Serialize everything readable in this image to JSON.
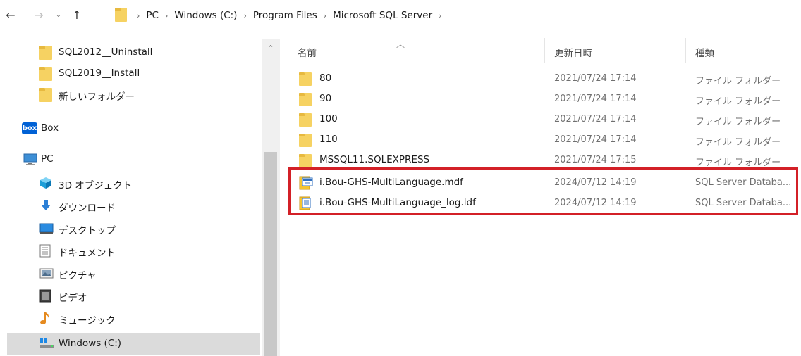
{
  "breadcrumb": [
    "PC",
    "Windows (C:)",
    "Program Files",
    "Microsoft SQL Server"
  ],
  "nav": {
    "items": [
      {
        "label": "SQL2012__Uninstall",
        "icon": "folder-icon"
      },
      {
        "label": "SQL2019__Install",
        "icon": "folder-icon"
      },
      {
        "label": "新しいフォルダー",
        "icon": "folder-icon"
      },
      {
        "label": "Box",
        "icon": "box-icon"
      },
      {
        "label": "PC",
        "icon": "pc-icon"
      },
      {
        "label": "3D オブジェクト",
        "icon": "3d-objects-icon"
      },
      {
        "label": "ダウンロード",
        "icon": "download-icon"
      },
      {
        "label": "デスクトップ",
        "icon": "desktop-icon"
      },
      {
        "label": "ドキュメント",
        "icon": "documents-icon"
      },
      {
        "label": "ピクチャ",
        "icon": "pictures-icon"
      },
      {
        "label": "ビデオ",
        "icon": "videos-icon"
      },
      {
        "label": "ミュージック",
        "icon": "music-icon"
      },
      {
        "label": "Windows (C:)",
        "icon": "drive-icon"
      }
    ],
    "box_logo_text": "box"
  },
  "columns": {
    "name": "名前",
    "date": "更新日時",
    "type": "種類"
  },
  "files": [
    {
      "name": "80",
      "date": "2021/07/24 17:14",
      "type": "ファイル フォルダー",
      "icon": "folder-icon"
    },
    {
      "name": "90",
      "date": "2021/07/24 17:14",
      "type": "ファイル フォルダー",
      "icon": "folder-icon"
    },
    {
      "name": "100",
      "date": "2021/07/24 17:14",
      "type": "ファイル フォルダー",
      "icon": "folder-icon"
    },
    {
      "name": "110",
      "date": "2021/07/24 17:14",
      "type": "ファイル フォルダー",
      "icon": "folder-icon"
    },
    {
      "name": "MSSQL11.SQLEXPRESS",
      "date": "2021/07/24 17:15",
      "type": "ファイル フォルダー",
      "icon": "folder-icon"
    },
    {
      "name": "i.Bou-GHS-MultiLanguage.mdf",
      "date": "2024/07/12 14:19",
      "type": "SQL Server Databa...",
      "icon": "sql-database-file-icon"
    },
    {
      "name": "i.Bou-GHS-MultiLanguage_log.ldf",
      "date": "2024/07/12 14:19",
      "type": "SQL Server Databa...",
      "icon": "sql-log-file-icon"
    }
  ],
  "colors": {
    "highlight_border": "#d32027",
    "folder": "#f6d262",
    "box_brand": "#0061d5"
  }
}
